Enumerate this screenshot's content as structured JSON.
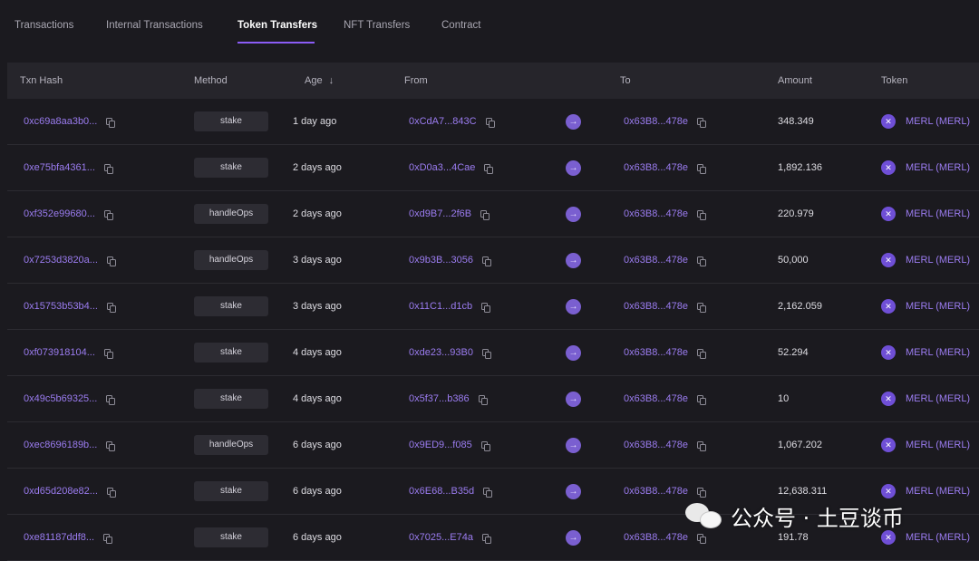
{
  "tabs": [
    {
      "label": "Transactions"
    },
    {
      "label": "Internal Transactions"
    },
    {
      "label": "Token Transfers"
    },
    {
      "label": "NFT Transfers"
    },
    {
      "label": "Contract"
    }
  ],
  "active_tab": "Token Transfers",
  "columns": {
    "txn_hash": "Txn Hash",
    "method": "Method",
    "age": "Age",
    "age_sort_icon": "arrow-down-icon",
    "from": "From",
    "to": "To",
    "amount": "Amount",
    "token": "Token"
  },
  "rows": [
    {
      "hash": "0xc69a8aa3b0...",
      "method": "stake",
      "age": "1 day ago",
      "from": "0xCdA7...843C",
      "to": "0x63B8...478e",
      "amount": "348.349",
      "token": "MERL (MERL)"
    },
    {
      "hash": "0xe75bfa4361...",
      "method": "stake",
      "age": "2 days ago",
      "from": "0xD0a3...4Cae",
      "to": "0x63B8...478e",
      "amount": "1,892.136",
      "token": "MERL (MERL)"
    },
    {
      "hash": "0xf352e99680...",
      "method": "handleOps",
      "age": "2 days ago",
      "from": "0xd9B7...2f6B",
      "to": "0x63B8...478e",
      "amount": "220.979",
      "token": "MERL (MERL)"
    },
    {
      "hash": "0x7253d3820a...",
      "method": "handleOps",
      "age": "3 days ago",
      "from": "0x9b3B...3056",
      "to": "0x63B8...478e",
      "amount": "50,000",
      "token": "MERL (MERL)"
    },
    {
      "hash": "0x15753b53b4...",
      "method": "stake",
      "age": "3 days ago",
      "from": "0x11C1...d1cb",
      "to": "0x63B8...478e",
      "amount": "2,162.059",
      "token": "MERL (MERL)"
    },
    {
      "hash": "0xf073918104...",
      "method": "stake",
      "age": "4 days ago",
      "from": "0xde23...93B0",
      "to": "0x63B8...478e",
      "amount": "52.294",
      "token": "MERL (MERL)"
    },
    {
      "hash": "0x49c5b69325...",
      "method": "stake",
      "age": "4 days ago",
      "from": "0x5f37...b386",
      "to": "0x63B8...478e",
      "amount": "10",
      "token": "MERL (MERL)"
    },
    {
      "hash": "0xec8696189b...",
      "method": "handleOps",
      "age": "6 days ago",
      "from": "0x9ED9...f085",
      "to": "0x63B8...478e",
      "amount": "1,067.202",
      "token": "MERL (MERL)"
    },
    {
      "hash": "0xd65d208e82...",
      "method": "stake",
      "age": "6 days ago",
      "from": "0x6E68...B35d",
      "to": "0x63B8...478e",
      "amount": "12,638.311",
      "token": "MERL (MERL)"
    },
    {
      "hash": "0xe81187ddf8...",
      "method": "stake",
      "age": "6 days ago",
      "from": "0x7025...E74a",
      "to": "0x63B8...478e",
      "amount": "191.78",
      "token": "MERL (MERL)"
    }
  ],
  "watermark": {
    "text": "公众号 · 土豆谈币",
    "icon": "wechat-icon"
  },
  "colors": {
    "background": "#1b1a1f",
    "header_bg": "#26252b",
    "link": "#9b7cf0",
    "accent": "#8b5cf6"
  }
}
